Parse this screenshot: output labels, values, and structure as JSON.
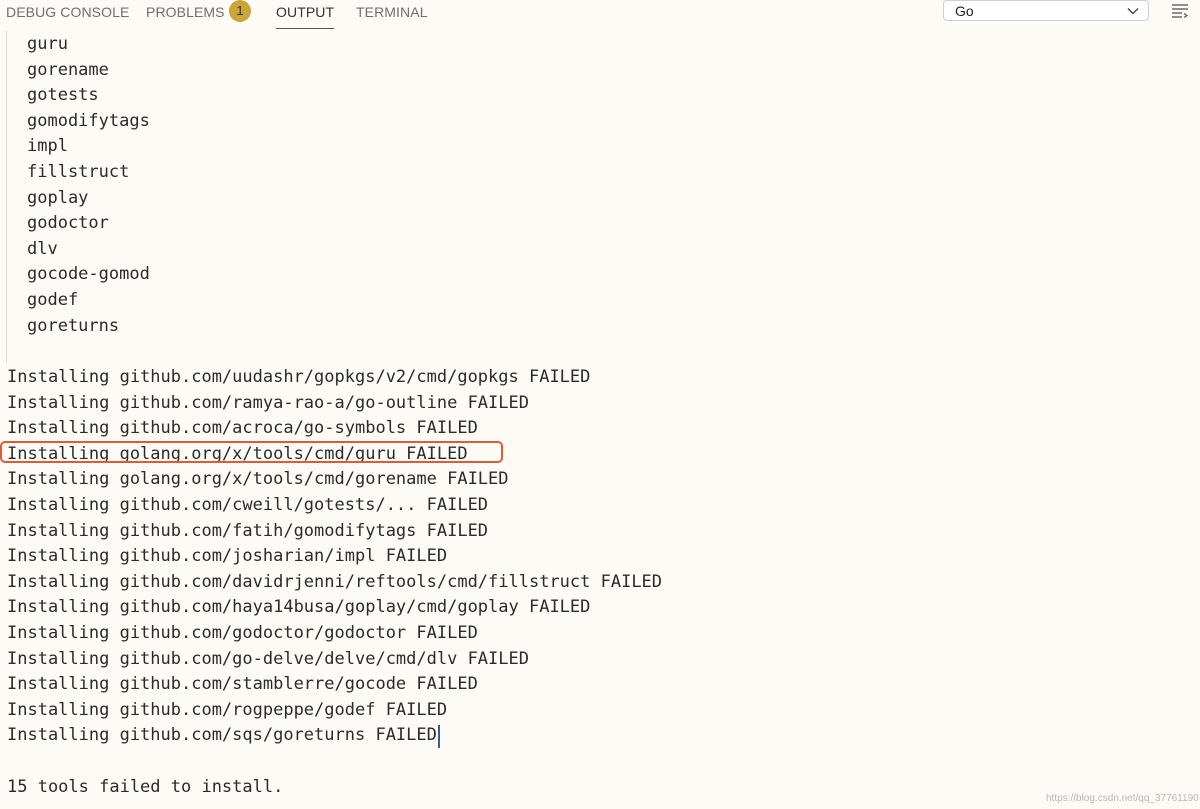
{
  "tabs": [
    {
      "label": "DEBUG CONSOLE"
    },
    {
      "label": "PROBLEMS",
      "badge": "1"
    },
    {
      "label": "OUTPUT"
    },
    {
      "label": "TERMINAL"
    }
  ],
  "active_tab": "OUTPUT",
  "output_channel": {
    "selected": "Go"
  },
  "output": {
    "tool_list": [
      "guru",
      "gorename",
      "gotests",
      "gomodifytags",
      "impl",
      "fillstruct",
      "goplay",
      "godoctor",
      "dlv",
      "gocode-gomod",
      "godef",
      "goreturns"
    ],
    "install_lines": [
      "Installing github.com/uudashr/gopkgs/v2/cmd/gopkgs FAILED",
      "Installing github.com/ramya-rao-a/go-outline FAILED",
      "Installing github.com/acroca/go-symbols FAILED",
      "Installing golang.org/x/tools/cmd/guru FAILED",
      "Installing golang.org/x/tools/cmd/gorename FAILED",
      "Installing github.com/cweill/gotests/... FAILED",
      "Installing github.com/fatih/gomodifytags FAILED",
      "Installing github.com/josharian/impl FAILED",
      "Installing github.com/davidrjenni/reftools/cmd/fillstruct FAILED",
      "Installing github.com/haya14busa/goplay/cmd/goplay FAILED",
      "Installing github.com/godoctor/godoctor FAILED",
      "Installing github.com/go-delve/delve/cmd/dlv FAILED",
      "Installing github.com/stamblerre/gocode FAILED",
      "Installing github.com/rogpeppe/godef FAILED",
      "Installing github.com/sqs/goreturns FAILED"
    ],
    "summary": "15 tools failed to install."
  },
  "watermark": "https://blog.csdn.net/qq_37761190",
  "icons": {
    "dropdown": "chevron-down-icon",
    "menu": "list-menu-icon"
  },
  "colors": {
    "background": "#fcfbf6",
    "highlight": "#e05a35",
    "badge": "#c9a53a"
  }
}
